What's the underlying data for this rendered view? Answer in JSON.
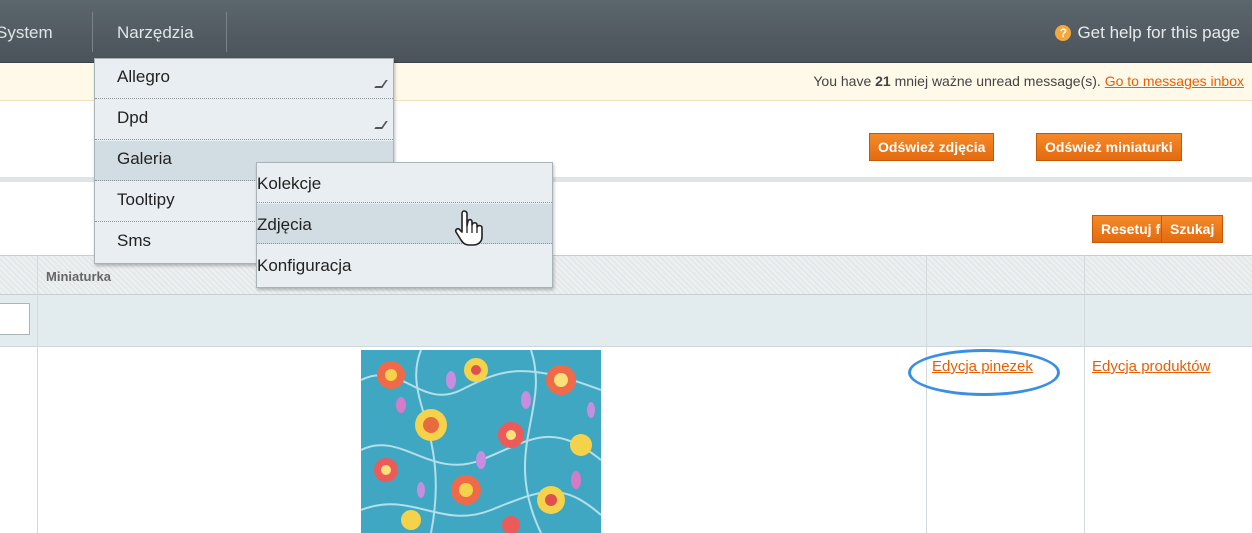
{
  "nav": {
    "items": [
      "System",
      "Narzędzia"
    ],
    "help": "Get help for this page"
  },
  "message_bar": {
    "prefix": "You have",
    "count": "21",
    "suffix": "mniej ważne unread message(s).",
    "link": "Go to messages inbox"
  },
  "actions": {
    "refresh_photos": "Odśwież zdjęcia",
    "refresh_thumbnails": "Odśwież miniaturki",
    "reset_filter": "Resetuj filtr",
    "search": "Szukaj"
  },
  "menu": {
    "items": [
      {
        "label": "Allegro",
        "has_submenu": true
      },
      {
        "label": "Dpd",
        "has_submenu": true
      },
      {
        "label": "Galeria",
        "has_submenu": true
      },
      {
        "label": "Tooltipy",
        "has_submenu": false
      },
      {
        "label": "Sms",
        "has_submenu": false
      }
    ],
    "submenu": [
      {
        "label": "Kolekcje"
      },
      {
        "label": "Zdjęcia",
        "active": true
      },
      {
        "label": "Konfiguracja"
      }
    ]
  },
  "grid": {
    "columns": [
      "Miniaturka",
      "",
      ""
    ],
    "row": {
      "edit_pins": "Edycja pinezek",
      "edit_products": "Edycja produktów"
    }
  },
  "colors": {
    "accent": "#eb5e00",
    "nav_bg": "#525b61",
    "highlight": "#3a8fe3"
  }
}
